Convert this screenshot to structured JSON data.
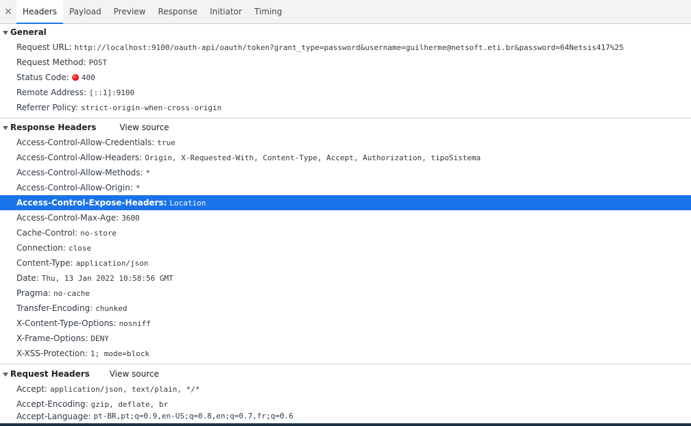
{
  "tabs": [
    "Headers",
    "Payload",
    "Preview",
    "Response",
    "Initiator",
    "Timing"
  ],
  "close_glyph": "×",
  "general": {
    "title": "General",
    "rows": [
      {
        "key": "Request URL:",
        "value": "http://localhost:9100/oauth-api/oauth/token?grant_type=password&username=guilherme@netsoft.eti.br&password=64Netsis417%25"
      },
      {
        "key": "Request Method:",
        "value": "POST"
      },
      {
        "key": "Status Code:",
        "value": "400"
      },
      {
        "key": "Remote Address:",
        "value": "[::1]:9100"
      },
      {
        "key": "Referrer Policy:",
        "value": "strict-origin-when-cross-origin"
      }
    ],
    "status_color": "#d50000"
  },
  "response_headers": {
    "title": "Response Headers",
    "view_source": "View source",
    "rows": [
      {
        "key": "Access-Control-Allow-Credentials:",
        "value": "true"
      },
      {
        "key": "Access-Control-Allow-Headers:",
        "value": "Origin, X-Requested-With, Content-Type, Accept, Authorization, tipoSistema"
      },
      {
        "key": "Access-Control-Allow-Methods:",
        "value": "*"
      },
      {
        "key": "Access-Control-Allow-Origin:",
        "value": "*"
      },
      {
        "key": "Access-Control-Expose-Headers:",
        "value": "Location"
      },
      {
        "key": "Access-Control-Max-Age:",
        "value": "3600"
      },
      {
        "key": "Cache-Control:",
        "value": "no-store"
      },
      {
        "key": "Connection:",
        "value": "close"
      },
      {
        "key": "Content-Type:",
        "value": "application/json"
      },
      {
        "key": "Date:",
        "value": "Thu, 13 Jan 2022 10:58:56 GMT"
      },
      {
        "key": "Pragma:",
        "value": "no-cache"
      },
      {
        "key": "Transfer-Encoding:",
        "value": "chunked"
      },
      {
        "key": "X-Content-Type-Options:",
        "value": "nosniff"
      },
      {
        "key": "X-Frame-Options:",
        "value": "DENY"
      },
      {
        "key": "X-XSS-Protection:",
        "value": "1; mode=block"
      }
    ],
    "selected_index": 4,
    "selected_color": "#1a73e8"
  },
  "request_headers": {
    "title": "Request Headers",
    "view_source": "View source",
    "rows": [
      {
        "key": "Accept:",
        "value": "application/json, text/plain, */*"
      },
      {
        "key": "Accept-Encoding:",
        "value": "gzip, deflate, br"
      },
      {
        "key": "Accept-Language:",
        "value": "pt-BR,pt;q=0.9,en-US;q=0.8,en;q=0.7,fr;q=0.6"
      }
    ]
  }
}
